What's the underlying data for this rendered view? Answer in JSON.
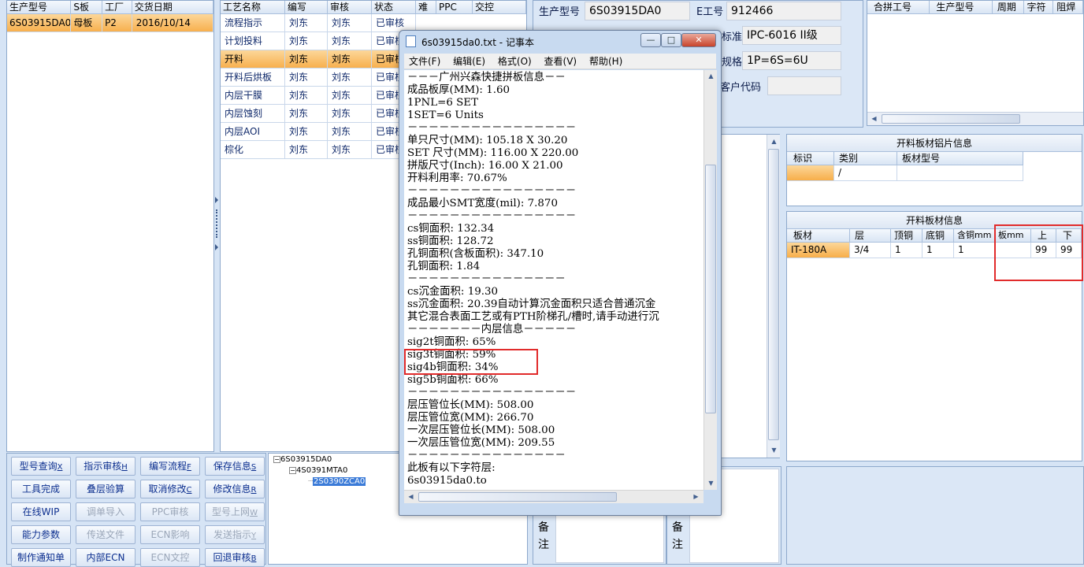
{
  "orders_table": {
    "headers": [
      "生产型号",
      "S板",
      "工厂",
      "交货日期"
    ],
    "rows": [
      [
        "6S03915DA0",
        "母板",
        "P2",
        "2016/10/14"
      ]
    ]
  },
  "process_table": {
    "headers": [
      "工艺名称",
      "编写",
      "审核",
      "状态",
      "难",
      "PPC",
      "交控"
    ],
    "rows": [
      [
        "流程指示",
        "刘东",
        "刘东",
        "已审核"
      ],
      [
        "计划投料",
        "刘东",
        "刘东",
        "已审核"
      ],
      [
        "开料",
        "刘东",
        "刘东",
        "已审核"
      ],
      [
        "开料后烘板",
        "刘东",
        "刘东",
        "已审核"
      ],
      [
        "内层干膜",
        "刘东",
        "刘东",
        "已审核"
      ],
      [
        "内层蚀刻",
        "刘东",
        "刘东",
        "已审核"
      ],
      [
        "内层AOI",
        "刘东",
        "刘东",
        "已审核"
      ],
      [
        "棕化",
        "刘东",
        "刘东",
        "已审核"
      ]
    ]
  },
  "buttons": [
    {
      "label": "型号查询",
      "key": "X",
      "enabled": true
    },
    {
      "label": "指示审核",
      "key": "H",
      "enabled": true
    },
    {
      "label": "编写流程",
      "key": "F",
      "enabled": true
    },
    {
      "label": "保存信息",
      "key": "S",
      "enabled": true
    },
    {
      "label": "工具完成",
      "key": "",
      "enabled": true
    },
    {
      "label": "叠层验算",
      "key": "",
      "enabled": true
    },
    {
      "label": "取消修改",
      "key": "C",
      "enabled": true
    },
    {
      "label": "修改信息",
      "key": "R",
      "enabled": true
    },
    {
      "label": "在线WIP",
      "key": "",
      "enabled": true
    },
    {
      "label": "调单导入",
      "key": "",
      "enabled": false
    },
    {
      "label": "PPC审核",
      "key": "",
      "enabled": false
    },
    {
      "label": "型号上网",
      "key": "W",
      "enabled": false
    },
    {
      "label": "能力参数",
      "key": "",
      "enabled": true
    },
    {
      "label": "传送文件",
      "key": "",
      "enabled": false
    },
    {
      "label": "ECN影响",
      "key": "",
      "enabled": false
    },
    {
      "label": "发送指示",
      "key": "Y",
      "enabled": false
    },
    {
      "label": "制作通知单",
      "key": "",
      "enabled": true
    },
    {
      "label": "内部ECN",
      "key": "",
      "enabled": true
    },
    {
      "label": "ECN文控",
      "key": "",
      "enabled": false
    },
    {
      "label": "回退审核",
      "key": "B",
      "enabled": true
    }
  ],
  "tree": [
    "6S03915DA0",
    "4S0391MTA0",
    "2S0390ZCA0"
  ],
  "info_fields": {
    "model_label": "生产型号",
    "model_value": "6S03915DA0",
    "e_label": "E工号",
    "e_value": "912466",
    "std_label": "标准",
    "std_value": "IPC-6016 II级",
    "spec_label": "规格",
    "spec_value": "1P=6S=6U",
    "cust_label": "客户代码",
    "cust_value": ""
  },
  "merge_table": {
    "headers": [
      "合拼工号",
      "生产型号",
      "周期",
      "字符",
      "阻焊"
    ]
  },
  "alu_section": {
    "title": "开料板材铝片信息",
    "headers": [
      "标识",
      "类别",
      "板材型号"
    ],
    "row": [
      "",
      "/",
      ""
    ]
  },
  "board_section": {
    "title": "开料板材信息",
    "headers": [
      "板材",
      "层",
      "顶铜",
      "底铜",
      "含铜mm",
      "板mm",
      "上",
      "下"
    ],
    "row": [
      "IT-180A",
      "3/4",
      "1",
      "1",
      "1",
      "",
      "99",
      "99"
    ]
  },
  "remarks": {
    "label1": "备",
    "label2": "注"
  },
  "notepad": {
    "title": "6s03915da0.txt - 记事本",
    "menu": [
      "文件(F)",
      "编辑(E)",
      "格式(O)",
      "查看(V)",
      "帮助(H)"
    ],
    "lines": [
      "－－－广州兴森快捷拼板信息－－",
      "成品板厚(MM): 1.60",
      "1PNL=6 SET",
      "1SET=6 Units",
      "－－－－－－－－－－－－－－－－",
      "单只尺寸(MM): 105.18 X 30.20",
      "SET 尺寸(MM): 116.00 X 220.00",
      "拼版尺寸(Inch): 16.00 X 21.00",
      "开料利用率: 70.67%",
      "－－－－－－－－－－－－－－－－",
      "成品最小SMT宽度(mil): 7.870",
      "－－－－－－－－－－－－－－－－",
      "cs铜面积: 132.34",
      "ss铜面积: 128.72",
      "孔铜面积(含板面积): 347.10",
      "孔铜面积: 1.84",
      "－－－－－－－－－－－－－－－",
      "cs沉金面积: 19.30",
      "ss沉金面积: 20.39自动计算沉金面积只适合普通沉金",
      "其它混合表面工艺或有PTH阶梯孔/槽时,请手动进行沉",
      "－－－－－－－内层信息－－－－－",
      "sig2t铜面积: 65%",
      "sig3t铜面积: 59%",
      "sig4b铜面积: 34%",
      "sig5b铜面积: 66%",
      "－－－－－－－－－－－－－－－－",
      "层压管位长(MM): 508.00",
      "层压管位宽(MM): 266.70",
      "一次层压管位长(MM): 508.00",
      "一次层压管位宽(MM): 209.55",
      "－－－－－－－－－－－－－－－",
      "此板有以下字符层:",
      "6s03915da0.to"
    ]
  }
}
